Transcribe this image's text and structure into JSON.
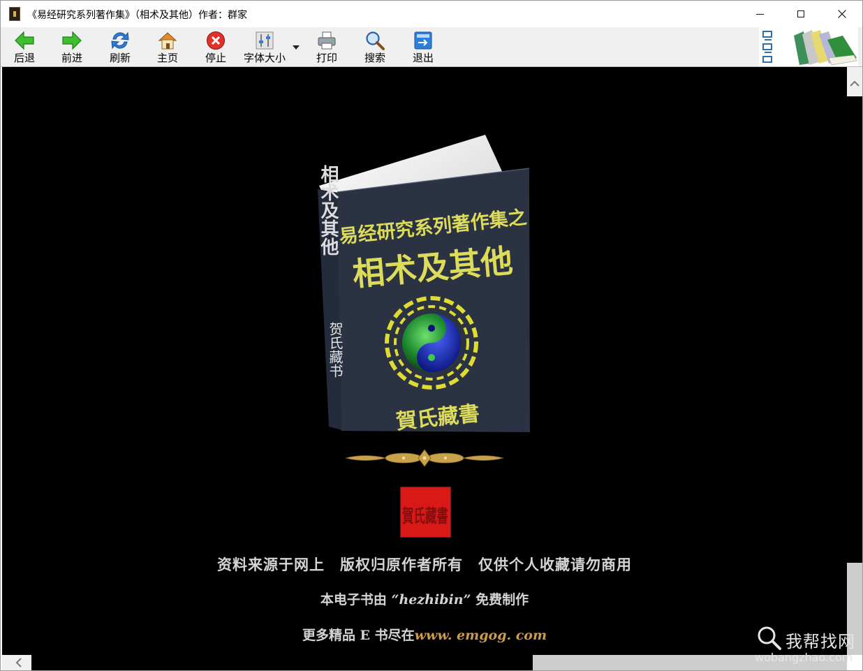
{
  "window": {
    "title": "《易经研究系列著作集》（相术及其他）作者：群家"
  },
  "toolbar": {
    "buttons": [
      {
        "label": "后退",
        "icon": "back-arrow-icon"
      },
      {
        "label": "前进",
        "icon": "forward-arrow-icon"
      },
      {
        "label": "刷新",
        "icon": "refresh-icon"
      },
      {
        "label": "主页",
        "icon": "home-icon"
      },
      {
        "label": "停止",
        "icon": "stop-icon"
      },
      {
        "label": "字体大小",
        "icon": "font-size-icon"
      },
      {
        "label": "打印",
        "icon": "printer-icon"
      },
      {
        "label": "搜索",
        "icon": "magnifier-icon"
      },
      {
        "label": "退出",
        "icon": "exit-icon"
      }
    ]
  },
  "cover": {
    "series_title": "易经研究系列著作集之",
    "book_title": "相术及其他",
    "spine_title": "相术及其他",
    "spine_publisher": "贺氏藏书",
    "publisher_mark": "賀氏藏書",
    "seal_text": "賀氏藏書"
  },
  "content": {
    "line1": "资料来源于网上　版权归原作者所有　仅供个人收藏请勿商用",
    "line2_prefix": "本电子书由",
    "line2_name": "“hezhibin”",
    "line2_suffix": "免费制作",
    "line3_prefix": "更多精品 E 书尽在",
    "line3_url": "www. emgog. com"
  },
  "watermark": {
    "text_cn": "我帮找网",
    "text_en": "wobangzhao.com"
  },
  "colors": {
    "content_bg": "#000000",
    "cover_bg": "#2b3343",
    "cover_text": "#d8d85a",
    "seal": "#d91818",
    "url": "#cf9b45"
  }
}
